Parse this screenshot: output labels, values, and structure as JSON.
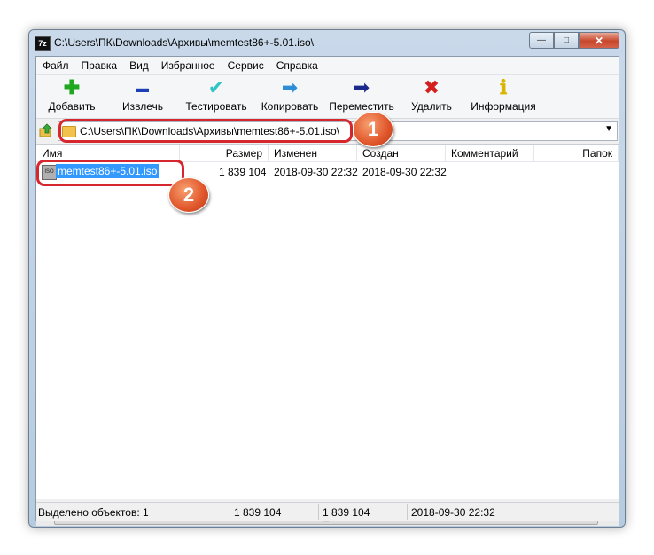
{
  "window": {
    "title": "C:\\Users\\ПК\\Downloads\\Архивы\\memtest86+-5.01.iso\\",
    "app_icon_label": "7z",
    "controls": {
      "minimize": "—",
      "maximize": "□",
      "close": "✕"
    }
  },
  "menu": [
    "Файл",
    "Правка",
    "Вид",
    "Избранное",
    "Сервис",
    "Справка"
  ],
  "toolbar": [
    {
      "label": "Добавить",
      "icon": "add-plus-icon",
      "glyph": "✚",
      "color": "#1fa81f"
    },
    {
      "label": "Извлечь",
      "icon": "extract-minus-icon",
      "glyph": "▬",
      "color": "#1c3fb5"
    },
    {
      "label": "Тестировать",
      "icon": "test-check-icon",
      "glyph": "✔",
      "color": "#2fc4c4"
    },
    {
      "label": "Копировать",
      "icon": "copy-arrow-icon",
      "glyph": "➡",
      "color": "#2c8fd6"
    },
    {
      "label": "Переместить",
      "icon": "move-arrow-icon",
      "glyph": "➡",
      "color": "#1a2a8a"
    },
    {
      "label": "Удалить",
      "icon": "delete-x-icon",
      "glyph": "✖",
      "color": "#d41f1f"
    },
    {
      "label": "Информация",
      "icon": "info-icon",
      "glyph": "ℹ",
      "color": "#d9b400"
    }
  ],
  "address": {
    "path": "C:\\Users\\ПК\\Downloads\\Архивы\\memtest86+-5.01.iso\\",
    "dropdown_glyph": "▼"
  },
  "columns": [
    "Имя",
    "Размер",
    "Изменен",
    "Создан",
    "Комментарий",
    "Папок"
  ],
  "files": [
    {
      "name": "memtest86+-5.01.iso",
      "icon_label": "ISO",
      "size": "1 839 104",
      "modified": "2018-09-30 22:32",
      "created": "2018-09-30 22:32",
      "comment": "",
      "folders": ""
    }
  ],
  "scrollbar": {
    "left": "◀",
    "right": "▶",
    "grip": "|||"
  },
  "status": {
    "selected": "Выделено объектов: 1",
    "size1": "1 839 104",
    "size2": "1 839 104",
    "date": "2018-09-30 22:32"
  },
  "callouts": [
    "1",
    "2"
  ],
  "colors": {
    "selection": "#3399ff",
    "callout_frame": "#d6272e",
    "callout_badge": "#e0552a"
  }
}
